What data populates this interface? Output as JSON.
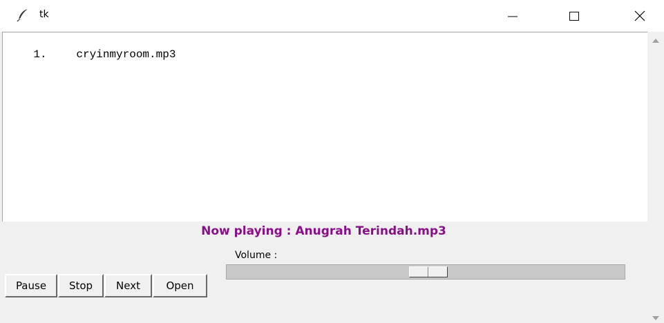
{
  "window": {
    "title": "tk",
    "icon": "feather-icon",
    "controls": [
      "minimize-icon",
      "maximize-icon",
      "close-icon"
    ]
  },
  "playlist": {
    "items": [
      {
        "number": "1.",
        "filename": "cryinmyroom.mp3"
      }
    ]
  },
  "status": {
    "now_playing": "Now playing : Anugrah Terindah.mp3",
    "color": "#8a0d8a"
  },
  "volume": {
    "label": "Volume :",
    "level_fraction": 0.5
  },
  "buttons": {
    "pause": "Pause",
    "stop": "Stop",
    "next": "Next",
    "open": "Open"
  }
}
